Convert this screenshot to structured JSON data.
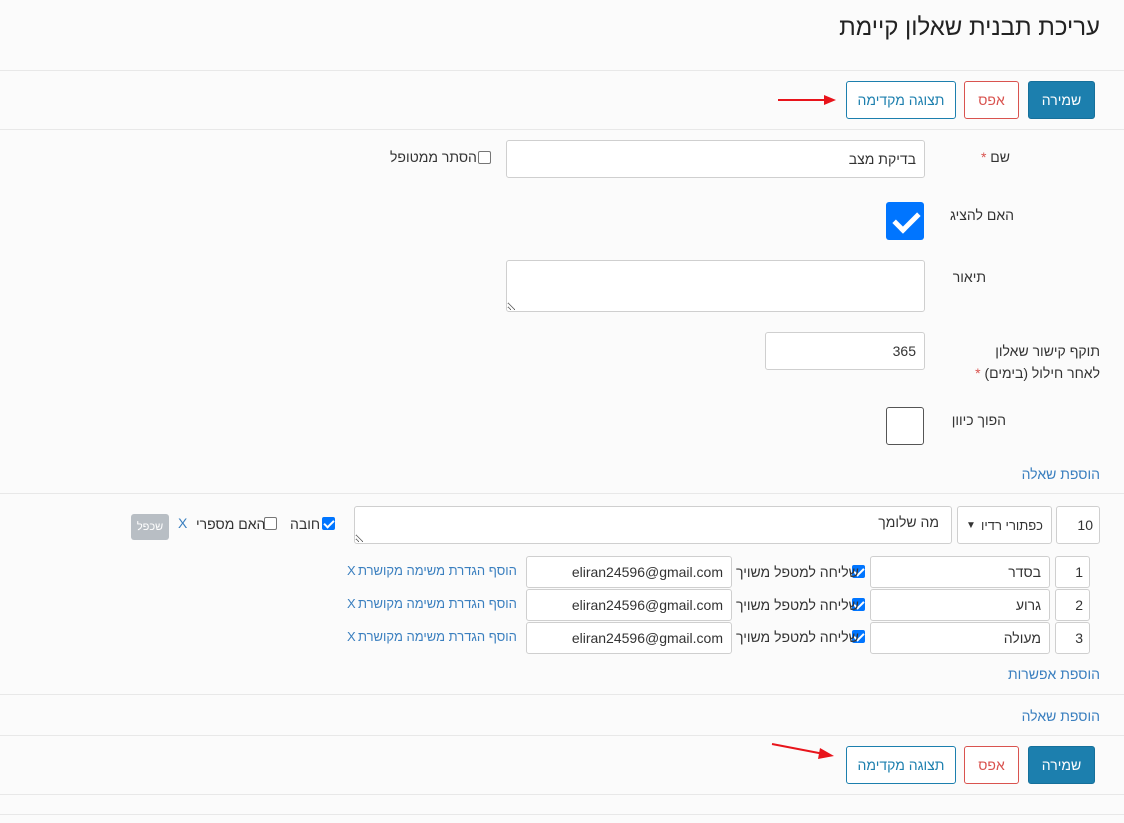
{
  "page_title": "עריכת תבנית שאלון קיימת",
  "toolbar": {
    "save_label": "שמירה",
    "reset_label": "אפס",
    "preview_label": "תצוגה מקדימה"
  },
  "form": {
    "name_label": "שם",
    "required_mark": "*",
    "name_value": "בדיקת מצב",
    "hide_from_patient_label": "הסתר ממטופל",
    "hide_from_patient_checked": false,
    "show_label": "האם להציג",
    "show_checked": true,
    "description_label": "תיאור",
    "description_value": "",
    "validity_label_line1": "תוקף קישור שאלון",
    "validity_label_line2": "לאחר חילול (בימים)",
    "validity_value": "365",
    "reverse_label": "הפוך כיוון",
    "reverse_checked": false,
    "add_question_label": "הוספת שאלה"
  },
  "question": {
    "order": "10",
    "type": "כפתורי רדיו",
    "text": "מה שלומך",
    "required_label": "חובה",
    "required_checked": true,
    "numeric_label": "האם מספרי",
    "numeric_checked": false,
    "remove_label": "X",
    "duplicate_label": "שכפל",
    "options": [
      {
        "num": "1",
        "text": "בסדר",
        "send_label": "שליחה למטפל משויך",
        "send_checked": true,
        "email": "eliran24596@gmail.com",
        "add_task_label": "הוסף הגדרת משימה מקושרת",
        "remove_label": "X"
      },
      {
        "num": "2",
        "text": "גרוע",
        "send_label": "שליחה למטפל משויך",
        "send_checked": true,
        "email": "eliran24596@gmail.com",
        "add_task_label": "הוסף הגדרת משימה מקושרת",
        "remove_label": "X"
      },
      {
        "num": "3",
        "text": "מעולה",
        "send_label": "שליחה למטפל משויך",
        "send_checked": true,
        "email": "eliran24596@gmail.com",
        "add_task_label": "הוסף הגדרת משימה מקושרת",
        "remove_label": "X"
      }
    ],
    "add_option_label": "הוספת אפשרות"
  },
  "bottom": {
    "add_question_label": "הוספת שאלה"
  },
  "colors": {
    "primary": "#1c7fae",
    "danger": "#d9534f",
    "link": "#3a7fbf",
    "checkbox": "#0075ff",
    "annotation_arrow": "#e8141b"
  }
}
